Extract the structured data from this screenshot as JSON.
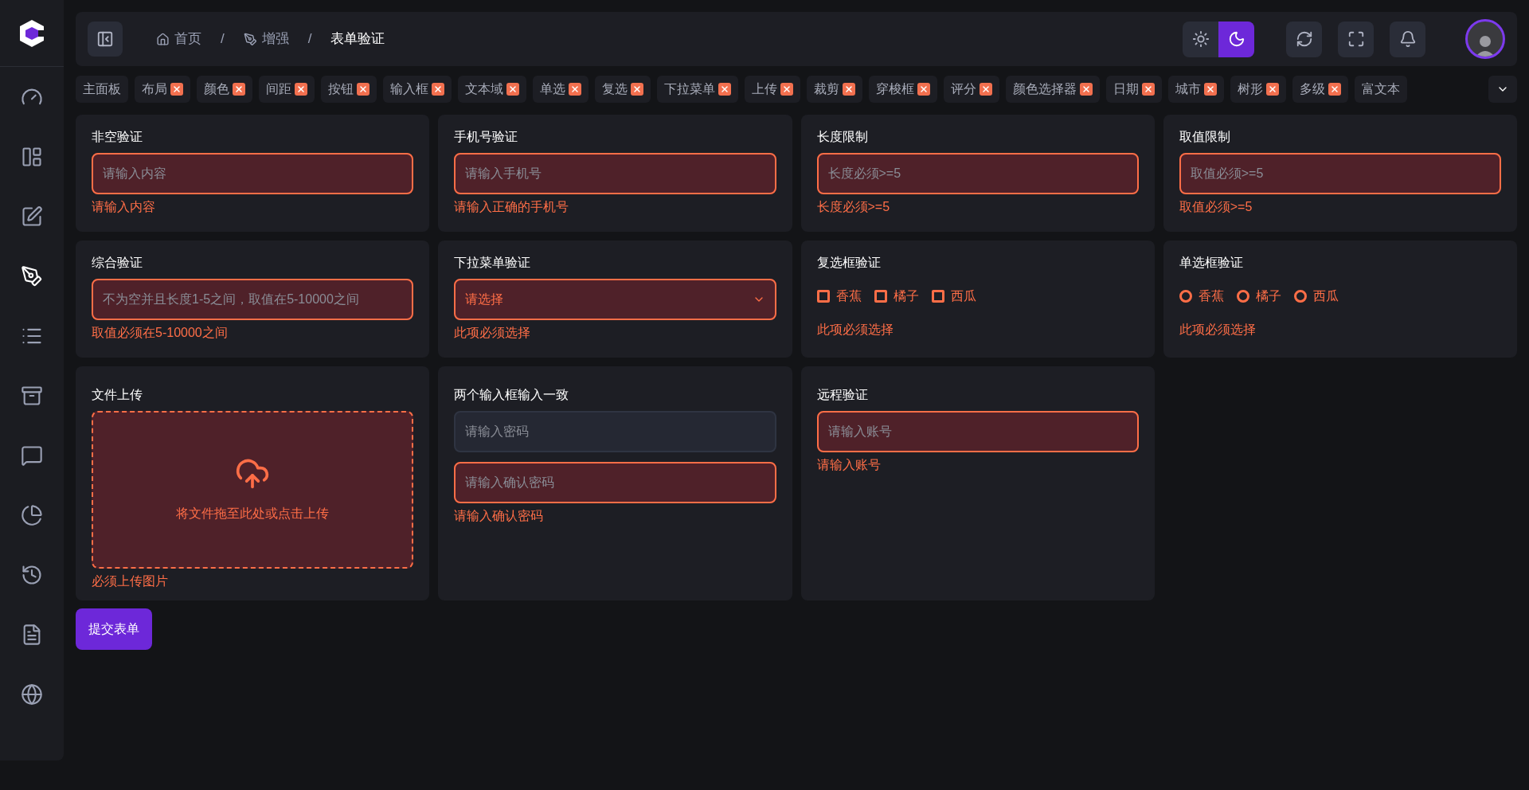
{
  "sidebar": {
    "items": [
      {
        "kind": "dashboard",
        "selected": false
      },
      {
        "kind": "layout",
        "selected": false
      },
      {
        "kind": "edit",
        "selected": false
      },
      {
        "kind": "pen",
        "selected": true
      },
      {
        "kind": "list",
        "selected": false
      },
      {
        "kind": "archive",
        "selected": false
      },
      {
        "kind": "chat",
        "selected": false
      },
      {
        "kind": "chart",
        "selected": false
      },
      {
        "kind": "history",
        "selected": false
      },
      {
        "kind": "document",
        "selected": false
      },
      {
        "kind": "browser",
        "selected": false
      }
    ]
  },
  "breadcrumb": [
    {
      "label": "首页",
      "kind": "home",
      "current": false
    },
    {
      "label": "增强",
      "kind": "pen",
      "current": false
    },
    {
      "label": "表单验证",
      "kind": "none",
      "current": true
    }
  ],
  "breadcrumb_separator": "/",
  "theme": {
    "dark": true
  },
  "tabs": [
    {
      "label": "主面板",
      "closable": false
    },
    {
      "label": "布局",
      "closable": true
    },
    {
      "label": "颜色",
      "closable": true
    },
    {
      "label": "间距",
      "closable": true
    },
    {
      "label": "按钮",
      "closable": true
    },
    {
      "label": "输入框",
      "closable": true
    },
    {
      "label": "文本域",
      "closable": true
    },
    {
      "label": "单选",
      "closable": true
    },
    {
      "label": "复选",
      "closable": true
    },
    {
      "label": "下拉菜单",
      "closable": true
    },
    {
      "label": "上传",
      "closable": true
    },
    {
      "label": "裁剪",
      "closable": true
    },
    {
      "label": "穿梭框",
      "closable": true
    },
    {
      "label": "评分",
      "closable": true
    },
    {
      "label": "颜色选择器",
      "closable": true
    },
    {
      "label": "日期",
      "closable": true
    },
    {
      "label": "城市",
      "closable": true
    },
    {
      "label": "树形",
      "closable": true
    },
    {
      "label": "多级",
      "closable": true
    },
    {
      "label": "富文本",
      "closable": false
    }
  ],
  "cards": [
    {
      "kind": "input",
      "title": "非空验证",
      "fields": [
        {
          "placeholder": "请输入内容",
          "invalid": true
        }
      ],
      "error": "请输入内容"
    },
    {
      "kind": "input",
      "title": "手机号验证",
      "fields": [
        {
          "placeholder": "请输入手机号",
          "invalid": true
        }
      ],
      "error": "请输入正确的手机号"
    },
    {
      "kind": "input",
      "title": "长度限制",
      "fields": [
        {
          "placeholder": "长度必须>=5",
          "invalid": true
        }
      ],
      "error": "长度必须>=5"
    },
    {
      "kind": "input",
      "title": "取值限制",
      "fields": [
        {
          "placeholder": "取值必须>=5",
          "invalid": true
        }
      ],
      "error": "取值必须>=5"
    },
    {
      "kind": "input",
      "title": "综合验证",
      "fields": [
        {
          "placeholder": "不为空并且长度1-5之间，取值在5-10000之间",
          "invalid": true
        }
      ],
      "error": "取值必须在5-10000之间"
    },
    {
      "kind": "select",
      "title": "下拉菜单验证",
      "value": "请选择",
      "invalid": true,
      "error": "此项必须选择"
    },
    {
      "kind": "checkbox",
      "title": "复选框验证",
      "options": [
        {
          "label": "香蕉",
          "checked": false
        },
        {
          "label": "橘子",
          "checked": false
        },
        {
          "label": "西瓜",
          "checked": false
        }
      ],
      "error": "此项必须选择"
    },
    {
      "kind": "radio",
      "title": "单选框验证",
      "options": [
        {
          "label": "香蕉",
          "checked": false
        },
        {
          "label": "橘子",
          "checked": false
        },
        {
          "label": "西瓜",
          "checked": false
        }
      ],
      "error": "此项必须选择"
    },
    {
      "kind": "upload",
      "title": "文件上传",
      "hint": "将文件拖至此处或点击上传",
      "invalid": true,
      "error": "必须上传图片"
    },
    {
      "kind": "input",
      "title": "两个输入框输入一致",
      "fields": [
        {
          "placeholder": "请输入密码",
          "invalid": false
        },
        {
          "placeholder": "请输入确认密码",
          "invalid": true
        }
      ],
      "error": "请输入确认密码"
    },
    {
      "kind": "input",
      "title": "远程验证",
      "fields": [
        {
          "placeholder": "请输入账号",
          "invalid": true
        }
      ],
      "error": "请输入账号"
    }
  ],
  "submit": "提交表单"
}
